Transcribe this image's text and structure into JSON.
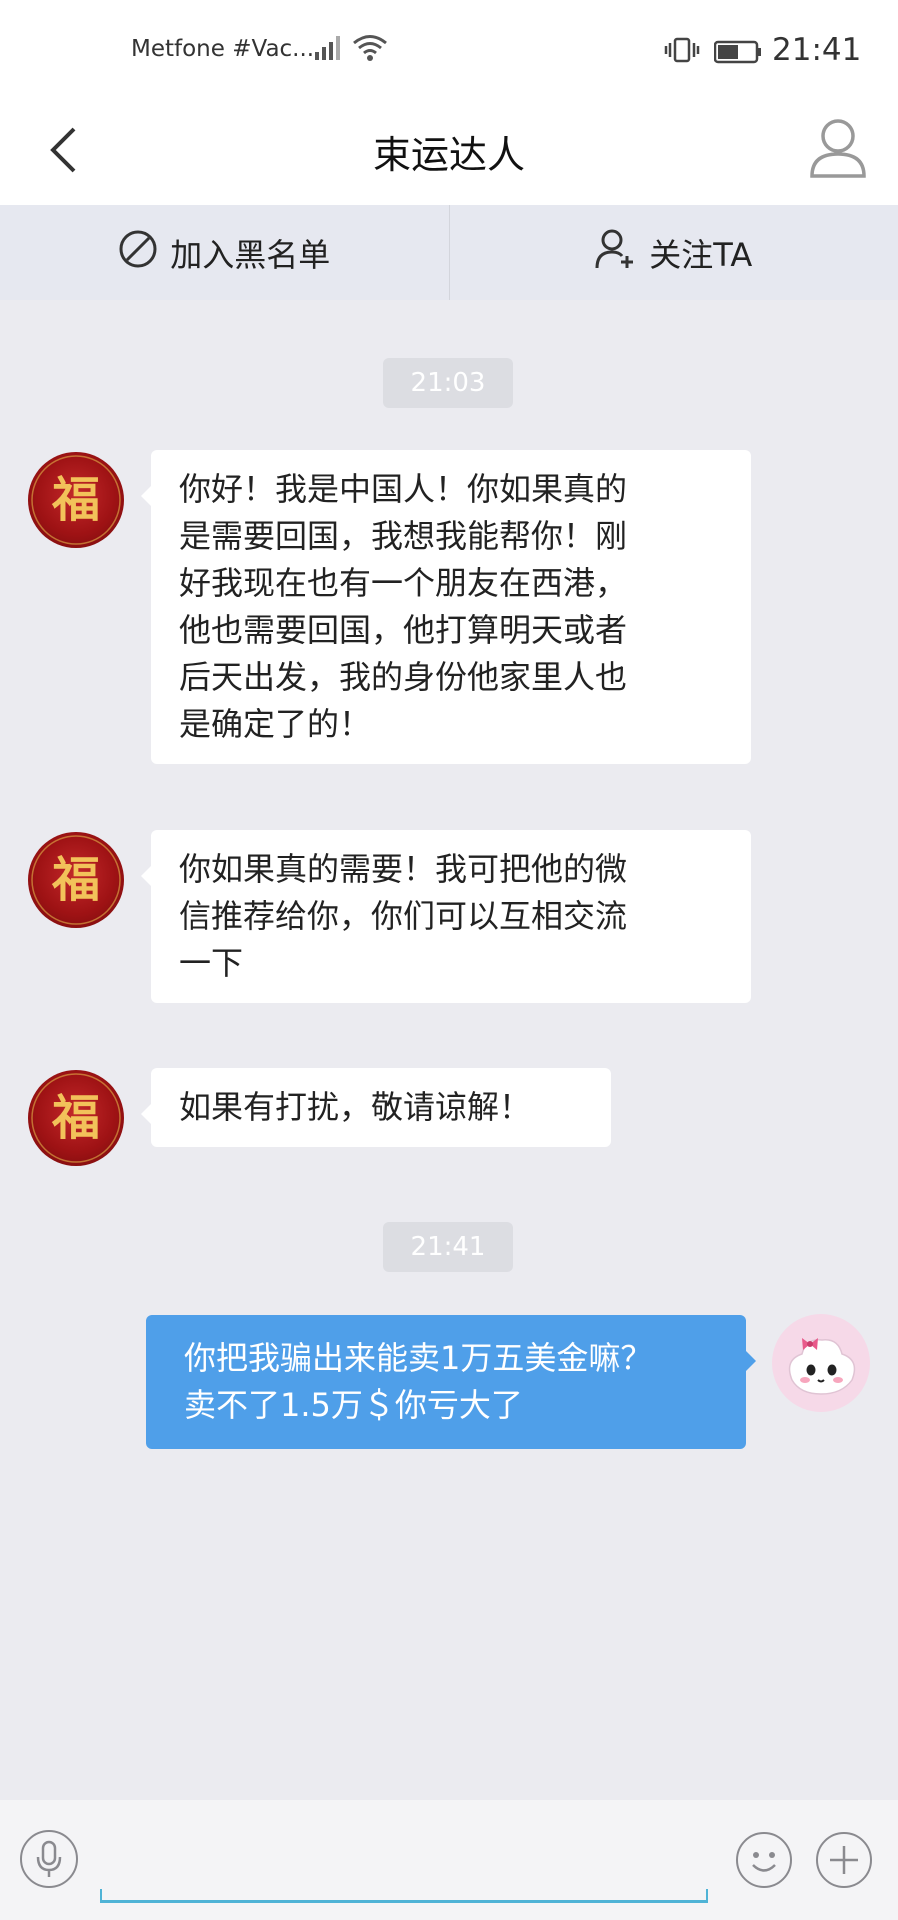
{
  "status_bar": {
    "carrier": "Metfone #Vac...",
    "time": "21:41"
  },
  "nav": {
    "title": "束运达人"
  },
  "actions": {
    "blacklist_label": "加入黑名单",
    "follow_label": "关注TA"
  },
  "messages": [
    {
      "timestamp": "21:03"
    },
    {
      "direction": "incoming",
      "lines": [
        "你好！我是中国人！你如果真的",
        "是需要回国，我想我能帮你！刚",
        "好我现在也有一个朋友在西港，",
        "他也需要回国，他打算明天或者",
        "后天出发，我的身份他家里人也",
        "是确定了的！"
      ]
    },
    {
      "direction": "incoming",
      "lines": [
        "你如果真的需要！我可把他的微",
        "信推荐给你，你们可以互相交流",
        "一下"
      ]
    },
    {
      "direction": "incoming",
      "lines": [
        "如果有打扰，敬请谅解！"
      ]
    },
    {
      "timestamp": "21:41"
    },
    {
      "direction": "outgoing",
      "lines": [
        "你把我骗出来能卖1万五美金嘛？",
        "卖不了1.5万＄你亏大了"
      ]
    }
  ],
  "avatar_left_glyph": "福",
  "colors": {
    "outgoing_bubble": "#4f9fe9",
    "incoming_bubble": "#ffffff",
    "chat_background": "#ebebf0",
    "input_underline": "#4fb3d6"
  },
  "icons": [
    "back-icon",
    "profile-icon",
    "block-icon",
    "add-user-icon",
    "mic-icon",
    "emoji-icon",
    "plus-icon"
  ]
}
